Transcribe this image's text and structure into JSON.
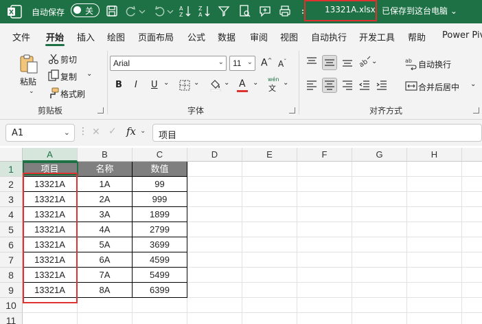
{
  "titlebar": {
    "autosave_label": "自动保存",
    "autosave_state": "关",
    "filename": "13321A.xlsx",
    "saved_status": "已保存到这台电脑 ⌄"
  },
  "tabs": [
    "文件",
    "开始",
    "插入",
    "绘图",
    "页面布局",
    "公式",
    "数据",
    "审阅",
    "视图",
    "自动执行",
    "开发工具",
    "帮助",
    "Power Piv"
  ],
  "active_tab": "开始",
  "ribbon": {
    "clipboard": {
      "paste": "粘贴",
      "cut": "剪切",
      "copy": "复制",
      "format_painter": "格式刷",
      "group_label": "剪贴板"
    },
    "font": {
      "font_name": "Arial",
      "font_size": "11",
      "bold": "B",
      "italic": "I",
      "underline": "U",
      "font_color": "A",
      "phonetic": "wén",
      "group_label": "字体"
    },
    "alignment": {
      "wrap_text": "自动换行",
      "merge_center": "合并后居中",
      "group_label": "对齐方式"
    }
  },
  "formula_bar": {
    "name_box": "A1",
    "fx": "fx",
    "content": "项目"
  },
  "grid": {
    "columns": [
      "A",
      "B",
      "C",
      "D",
      "E",
      "F",
      "G",
      "H"
    ],
    "rows": [
      "1",
      "2",
      "3",
      "4",
      "5",
      "6",
      "7",
      "8",
      "9",
      "10",
      "11"
    ],
    "headers": [
      "项目",
      "名称",
      "数值"
    ],
    "data": [
      [
        "13321A",
        "1A",
        "99"
      ],
      [
        "13321A",
        "2A",
        "999"
      ],
      [
        "13321A",
        "3A",
        "1899"
      ],
      [
        "13321A",
        "4A",
        "2799"
      ],
      [
        "13321A",
        "5A",
        "3699"
      ],
      [
        "13321A",
        "6A",
        "4599"
      ],
      [
        "13321A",
        "7A",
        "5499"
      ],
      [
        "13321A",
        "8A",
        "6399"
      ]
    ]
  },
  "colors": {
    "brand_green": "#1e7145",
    "highlight_red": "#e03131",
    "header_fill": "#7f7f7f"
  }
}
